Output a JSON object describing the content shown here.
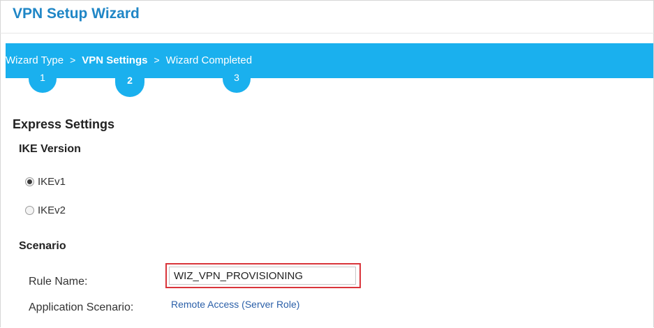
{
  "window": {
    "title": "VPN Setup Wizard"
  },
  "steps": {
    "items": [
      {
        "label": "Wizard Type",
        "number": "1"
      },
      {
        "label": "VPN Settings",
        "number": "2"
      },
      {
        "label": "Wizard Completed",
        "number": "3"
      }
    ],
    "separator": ">",
    "active_index": 1
  },
  "express": {
    "heading": "Express Settings",
    "ike": {
      "heading": "IKE Version",
      "options": [
        {
          "label": "IKEv1",
          "checked": true
        },
        {
          "label": "IKEv2",
          "checked": false
        }
      ]
    },
    "scenario": {
      "heading": "Scenario",
      "rule_name_label": "Rule Name:",
      "rule_name_value": "WIZ_VPN_PROVISIONING",
      "app_scenario_label": "Application Scenario:",
      "app_scenario_value": "Remote Access (Server Role)"
    }
  },
  "colors": {
    "accent": "#1ab0ee",
    "title": "#1f86c6",
    "highlight": "#d9343a",
    "link": "#2a5fa8"
  }
}
